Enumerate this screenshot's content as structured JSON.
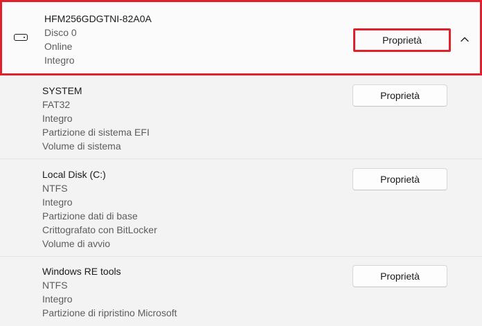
{
  "disk": {
    "name": "HFM256GDGTNI-82A0A",
    "details": [
      "Disco 0",
      "Online",
      "Integro"
    ],
    "properties_label": "Proprietà",
    "icon": "drive-icon",
    "expand_icon": "chevron-up-icon",
    "highlight_color": "#e0202b"
  },
  "partitions": [
    {
      "name": "SYSTEM",
      "details": [
        "FAT32",
        "Integro",
        "Partizione di sistema EFI",
        "Volume di sistema"
      ],
      "properties_label": "Proprietà"
    },
    {
      "name": "Local Disk (C:)",
      "details": [
        "NTFS",
        "Integro",
        "Partizione dati di base",
        "Crittografato con BitLocker",
        "Volume di avvio"
      ],
      "properties_label": "Proprietà"
    },
    {
      "name": "Windows RE tools",
      "details": [
        "NTFS",
        "Integro",
        "Partizione di ripristino Microsoft"
      ],
      "properties_label": "Proprietà"
    }
  ]
}
